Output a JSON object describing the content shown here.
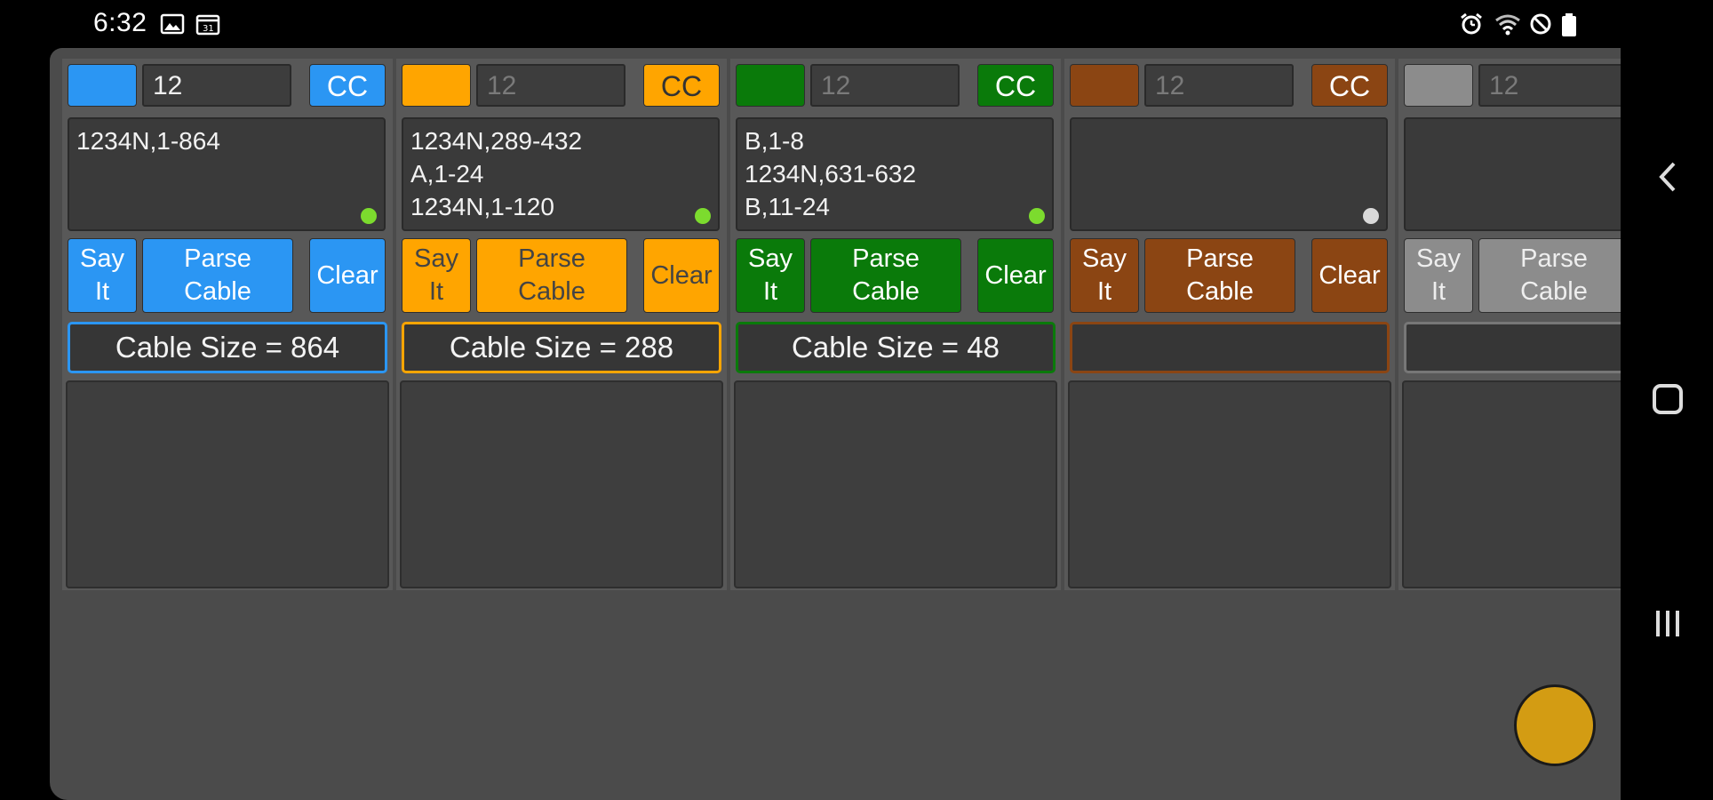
{
  "status_bar": {
    "time": "6:32",
    "left_icons": [
      "gallery-icon",
      "calendar-icon"
    ],
    "right_icons": [
      "alarm-icon",
      "wifi-icon",
      "do-not-disturb-icon",
      "battery-icon"
    ]
  },
  "nav_bar": {
    "buttons": [
      "back-icon",
      "home-icon",
      "recents-icon"
    ]
  },
  "columns": [
    {
      "color": "#2b96f3",
      "count_value": "12",
      "count_dim": false,
      "cc_label": "CC",
      "text_lines": [
        "1234N,1-864"
      ],
      "indicator_color": "#7cdb2e",
      "say_label_1": "Say",
      "say_label_2": "It",
      "parse_label_1": "Parse",
      "parse_label_2": "Cable",
      "clear_label": "Clear",
      "cable_size": "Cable Size = 864"
    },
    {
      "color": "#ffa500",
      "count_value": "12",
      "count_dim": true,
      "cc_label": "CC",
      "text_lines": [
        "1234N,289-432",
        "A,1-24",
        "1234N,1-120"
      ],
      "indicator_color": "#7cdb2e",
      "say_label_1": "Say",
      "say_label_2": "It",
      "parse_label_1": "Parse",
      "parse_label_2": "Cable",
      "clear_label": "Clear",
      "cable_size": "Cable Size = 288"
    },
    {
      "color": "#0a7a0a",
      "count_value": "12",
      "count_dim": true,
      "cc_label": "CC",
      "text_lines": [
        "B,1-8",
        "1234N,631-632",
        "B,11-24"
      ],
      "indicator_color": "#7cdb2e",
      "say_label_1": "Say",
      "say_label_2": "It",
      "parse_label_1": "Parse",
      "parse_label_2": "Cable",
      "clear_label": "Clear",
      "cable_size": "Cable Size = 48"
    },
    {
      "color": "#8b4513",
      "count_value": "12",
      "count_dim": true,
      "cc_label": "CC",
      "text_lines": [],
      "indicator_color": "#d9d9d9",
      "say_label_1": "Say",
      "say_label_2": "It",
      "parse_label_1": "Parse",
      "parse_label_2": "Cable",
      "clear_label": "Clear",
      "cable_size": ""
    },
    {
      "color": "#8c8c8c",
      "count_value": "12",
      "count_dim": true,
      "cc_label": "",
      "text_lines": [],
      "indicator_color": "",
      "say_label_1": "Say",
      "say_label_2": "It",
      "parse_label_1": "Parse",
      "parse_label_2": "Cable",
      "clear_label": "",
      "cable_size": ""
    }
  ],
  "fab": {
    "color": "#d39c13",
    "icon": "circle-button"
  }
}
